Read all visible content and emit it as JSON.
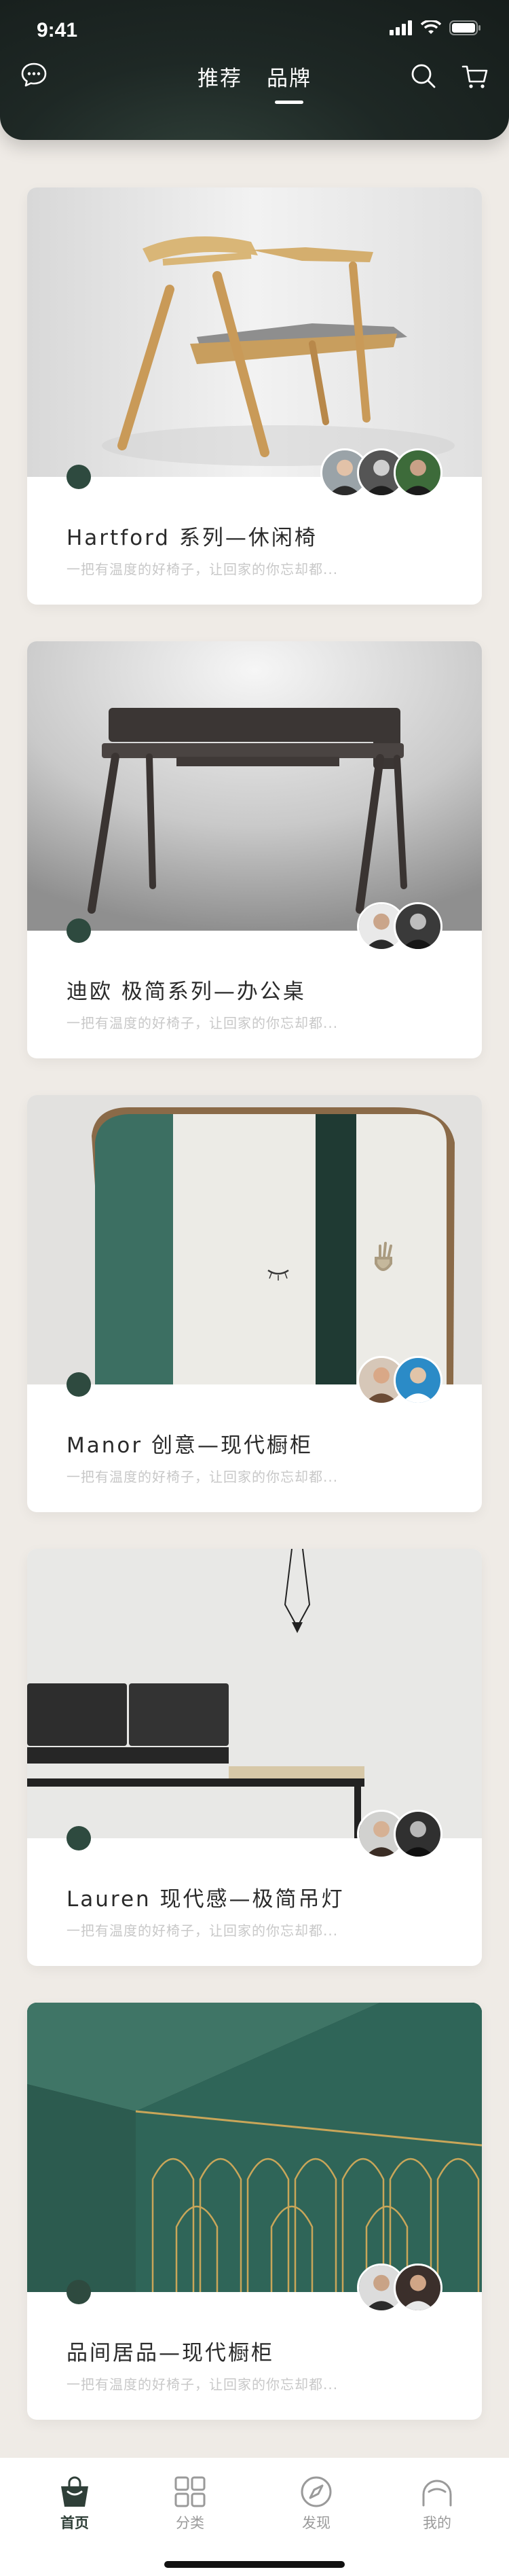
{
  "status_bar": {
    "time": "9:41"
  },
  "nav": {
    "tabs": [
      {
        "label": "推荐",
        "active": false
      },
      {
        "label": "品牌",
        "active": true
      }
    ]
  },
  "cards": [
    {
      "title": "Hartford 系列—休闲椅",
      "subtitle": "一把有温度的好椅子，让回家的你忘却都..."
    },
    {
      "title": "迪欧 极简系列—办公桌",
      "subtitle": "一把有温度的好椅子，让回家的你忘却都..."
    },
    {
      "title": "Manor 创意—现代橱柜",
      "subtitle": "一把有温度的好椅子，让回家的你忘却都..."
    },
    {
      "title": "Lauren 现代感—极简吊灯",
      "subtitle": "一把有温度的好椅子，让回家的你忘却都..."
    },
    {
      "title": "品间居品—现代橱柜",
      "subtitle": "一把有温度的好椅子，让回家的你忘却都..."
    }
  ],
  "tabbar": {
    "items": [
      {
        "label": "首页",
        "icon": "bag-icon",
        "active": true
      },
      {
        "label": "分类",
        "icon": "grid-icon",
        "active": false
      },
      {
        "label": "发现",
        "icon": "compass-icon",
        "active": false
      },
      {
        "label": "我的",
        "icon": "user-icon",
        "active": false
      }
    ]
  },
  "colors": {
    "header_bg": "#1e2825",
    "accent": "#2e4a3f",
    "page_bg": "#efebe6"
  }
}
